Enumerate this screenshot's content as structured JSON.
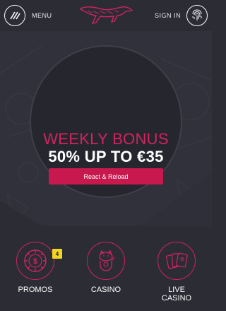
{
  "header": {
    "menu_label": "MENU",
    "signin_label": "SIGN IN",
    "menu_icon": "menu-slashes-icon",
    "logo_icon": "cheetah-logo-icon",
    "fingerprint_icon": "fingerprint-icon"
  },
  "promo": {
    "title": "WEEKLY BONUS",
    "subtitle": "50% UP TO €35",
    "button_label": "React & Reload"
  },
  "nav": {
    "items": [
      {
        "label": "PROMOS",
        "icon": "casino-chip-icon",
        "badge": "4"
      },
      {
        "label": "CASINO",
        "icon": "lucky-cat-icon"
      },
      {
        "label": "LIVE\nCASINO",
        "label_line1": "LIVE",
        "label_line2": "CASINO",
        "icon": "playing-cards-icon"
      }
    ]
  },
  "colors": {
    "background": "#2b2c34",
    "accent": "#d2245f",
    "button": "#c8194f",
    "badge": "#f2d422"
  }
}
